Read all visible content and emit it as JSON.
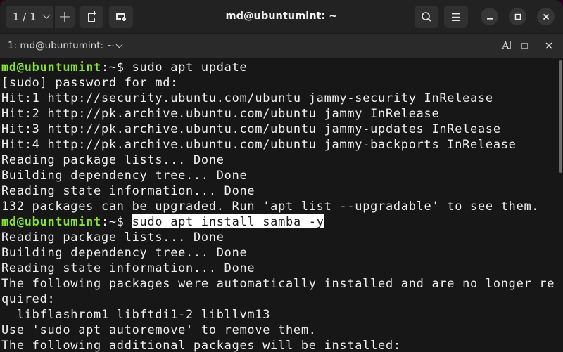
{
  "window": {
    "title": "md@ubuntumint: ~",
    "tab_counter": "1 / 1",
    "icons": {
      "tab_list": "chevron-down-icon",
      "new_tab": "plus-icon",
      "new_split": "new-tab-page-icon",
      "new_window": "new-window-icon",
      "search": "search-icon",
      "menu": "hamburger-menu-icon",
      "minimize": "minimize-icon",
      "maximize": "maximize-icon",
      "close": "close-icon"
    }
  },
  "tab": {
    "label": "1: md@ubuntumint: ~",
    "font_icon_label": "A",
    "icons": [
      "font-size-icon",
      "square-icon",
      "close-icon"
    ]
  },
  "colors": {
    "prompt": "#8ae234",
    "background": "#171717",
    "text": "#f0f0f0",
    "selection_bg": "#ffffff"
  },
  "terminal": {
    "prompt_user": "md@ubuntumint",
    "prompt_path": ":~",
    "prompt_symbol": "$ ",
    "lines": [
      {
        "type": "prompt",
        "command": "sudo apt update"
      },
      {
        "type": "output",
        "text": "[sudo] password for md:"
      },
      {
        "type": "output",
        "text": "Hit:1 http://security.ubuntu.com/ubuntu jammy-security InRelease"
      },
      {
        "type": "output",
        "text": "Hit:2 http://pk.archive.ubuntu.com/ubuntu jammy InRelease"
      },
      {
        "type": "output",
        "text": "Hit:3 http://pk.archive.ubuntu.com/ubuntu jammy-updates InRelease"
      },
      {
        "type": "output",
        "text": "Hit:4 http://pk.archive.ubuntu.com/ubuntu jammy-backports InRelease"
      },
      {
        "type": "output",
        "text": "Reading package lists... Done"
      },
      {
        "type": "output",
        "text": "Building dependency tree... Done"
      },
      {
        "type": "output",
        "text": "Reading state information... Done"
      },
      {
        "type": "output",
        "text": "132 packages can be upgraded. Run 'apt list --upgradable' to see them."
      },
      {
        "type": "prompt",
        "command": "sudo apt install samba -y",
        "selected": true
      },
      {
        "type": "output",
        "text": "Reading package lists... Done"
      },
      {
        "type": "output",
        "text": "Building dependency tree... Done"
      },
      {
        "type": "output",
        "text": "Reading state information... Done"
      },
      {
        "type": "output",
        "text": "The following packages were automatically installed and are no longer re"
      },
      {
        "type": "output",
        "text": "quired:"
      },
      {
        "type": "output",
        "text": "  libflashrom1 libftdi1-2 libllvm13"
      },
      {
        "type": "output",
        "text": "Use 'sudo apt autoremove' to remove them."
      },
      {
        "type": "output",
        "text": "The following additional packages will be installed:"
      }
    ]
  }
}
